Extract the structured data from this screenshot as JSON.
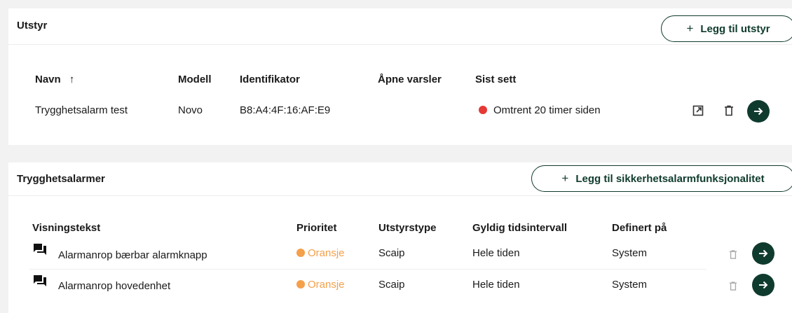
{
  "utstyr": {
    "title": "Utstyr",
    "add_label": "Legg til utstyr",
    "add_icon": "plus-icon",
    "columns": {
      "navn": "Navn",
      "sort_icon": "↑",
      "modell": "Modell",
      "identifikator": "Identifikator",
      "apne_varsler": "Åpne varsler",
      "sist_sett": "Sist sett"
    },
    "rows": [
      {
        "navn": "Trygghetsalarm test",
        "modell": "Novo",
        "identifikator": "B8:A4:4F:16:AF:E9",
        "apne_varsler": "",
        "sist_sett": "Omtrent 20 timer siden",
        "status_color": "#e53935"
      }
    ]
  },
  "alarmer": {
    "title": "Trygghetsalarmer",
    "add_label": "Legg til sikkerhetsalarmfunksjonalitet",
    "add_icon": "plus-icon",
    "columns": {
      "visningstekst": "Visningstekst",
      "prioritet": "Prioritet",
      "utstyrstype": "Utstyrstype",
      "tidsintervall": "Gyldig tidsintervall",
      "definert": "Definert på"
    },
    "rows": [
      {
        "visningstekst": "Alarmanrop bærbar alarmknapp",
        "prioritet": "Oransje",
        "prio_color": "#f5a04a",
        "utstyrstype": "Scaip",
        "tidsintervall": "Hele tiden",
        "definert": "System"
      },
      {
        "visningstekst": "Alarmanrop hovedenhet",
        "prioritet": "Oransje",
        "prio_color": "#f5a04a",
        "utstyrstype": "Scaip",
        "tidsintervall": "Hele tiden",
        "definert": "System"
      }
    ]
  },
  "colors": {
    "accent": "#0f3b2e",
    "status_red": "#e53935",
    "priority_orange": "#f5a04a"
  }
}
